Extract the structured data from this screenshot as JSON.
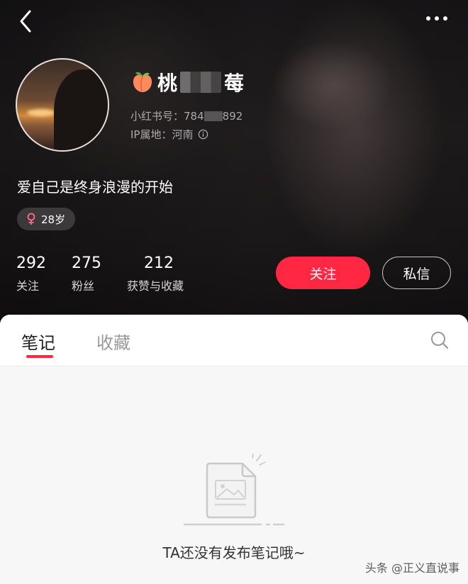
{
  "profile": {
    "nickname_start": "桃",
    "nickname_end": "莓",
    "id_label": "小红书号：",
    "id_start": "784",
    "id_end": "892",
    "ip_label": "IP属地：",
    "ip_value": "河南",
    "bio": "爱自己是终身浪漫的开始",
    "age": "28岁"
  },
  "stats": [
    {
      "value": "292",
      "label": "关注"
    },
    {
      "value": "275",
      "label": "粉丝"
    },
    {
      "value": "212",
      "label": "获赞与收藏"
    }
  ],
  "actions": {
    "follow": "关注",
    "message": "私信"
  },
  "tabs": {
    "notes": "笔记",
    "collections": "收藏"
  },
  "empty": {
    "text": "TA还没有发布笔记哦~"
  },
  "watermark": "头条 @正义直说事",
  "colors": {
    "accent": "#ff2742",
    "gender": "#ff6b8a"
  }
}
